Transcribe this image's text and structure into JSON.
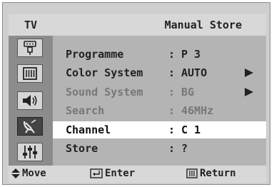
{
  "header": {
    "source": "TV",
    "title": "Manual Store"
  },
  "sidebar": {
    "items": [
      {
        "icon": "input-plug-icon"
      },
      {
        "icon": "picture-icon"
      },
      {
        "icon": "speaker-icon"
      },
      {
        "icon": "antenna-icon"
      },
      {
        "icon": "equalizer-icon"
      }
    ]
  },
  "menu": {
    "rows": [
      {
        "label": "Programme",
        "value": "P 3"
      },
      {
        "label": "Color System",
        "value": "AUTO"
      },
      {
        "label": "Sound System",
        "value": "BG"
      },
      {
        "label": "Search",
        "value": "46MHz"
      },
      {
        "label": "Channel",
        "value": "C 1"
      },
      {
        "label": "Store",
        "value": "?"
      }
    ],
    "separator": ":"
  },
  "footer": {
    "move": "Move",
    "enter": "Enter",
    "return": "Return"
  }
}
